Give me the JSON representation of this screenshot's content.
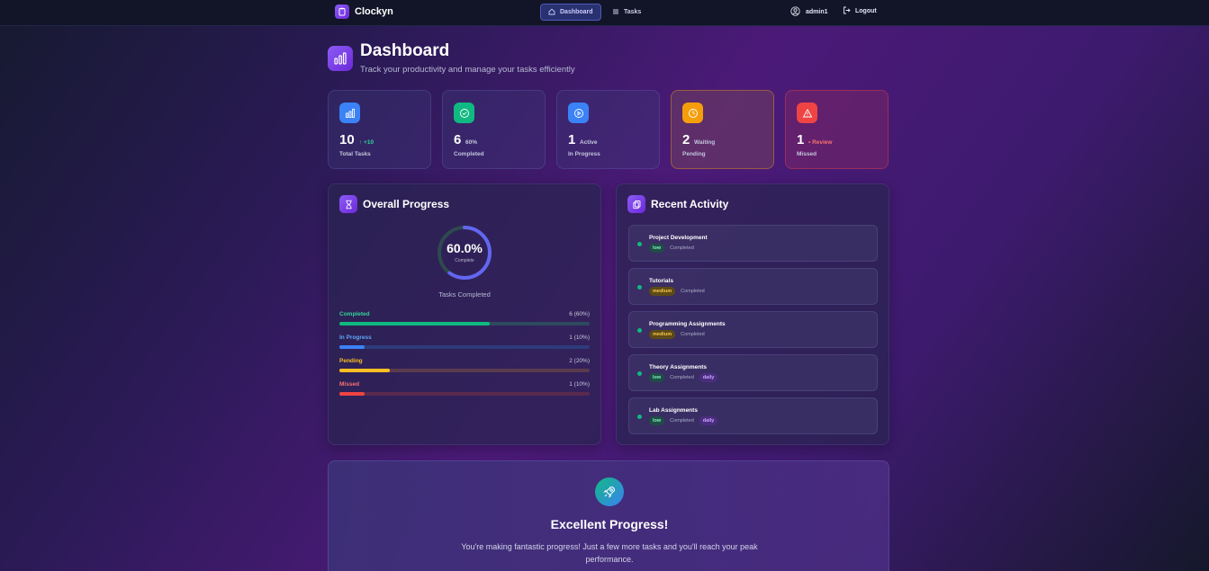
{
  "nav": {
    "brand": "Clockyn",
    "dashboard_label": "Dashboard",
    "tasks_label": "Tasks",
    "user": "admin1",
    "logout_label": "Logout"
  },
  "header": {
    "title": "Dashboard",
    "subtitle": "Track your productivity and manage your tasks efficiently"
  },
  "stats": [
    {
      "value": "10",
      "extra": "↑ +10",
      "label": "Total Tasks",
      "color": "#3b82f6"
    },
    {
      "value": "6",
      "extra": "60%",
      "label": "Completed",
      "color": "#10b981"
    },
    {
      "value": "1",
      "extra": "Active",
      "label": "In Progress",
      "color": "#3b82f6"
    },
    {
      "value": "2",
      "extra": "Waiting",
      "label": "Pending",
      "color": "#f59e0b"
    },
    {
      "value": "1",
      "extra": "• Review",
      "label": "Missed",
      "color": "#ef4444"
    }
  ],
  "overall": {
    "title": "Overall Progress",
    "percent_text": "60.0%",
    "percent": 60,
    "complete_label": "Complete",
    "caption": "Tasks Completed",
    "rows": [
      {
        "label": "Completed",
        "value": "6 (60%)",
        "fraction": 0.6,
        "color": "#10b981",
        "track": "#2e4a5e",
        "label_color": "#34d399"
      },
      {
        "label": "In Progress",
        "value": "1 (10%)",
        "fraction": 0.1,
        "color": "#3b82f6",
        "track": "#2d3b7a",
        "label_color": "#60a5fa"
      },
      {
        "label": "Pending",
        "value": "2 (20%)",
        "fraction": 0.2,
        "color": "#fbbf24",
        "track": "#5a3b4e",
        "label_color": "#fbbf24"
      },
      {
        "label": "Missed",
        "value": "1 (10%)",
        "fraction": 0.1,
        "color": "#ef4444",
        "track": "#5a2a4e",
        "label_color": "#f87171"
      }
    ]
  },
  "activity": {
    "title": "Recent Activity",
    "items": [
      {
        "title": "Project Development",
        "priority": "low",
        "status": "Completed",
        "tag": ""
      },
      {
        "title": "Tutorials",
        "priority": "medium",
        "status": "Completed",
        "tag": ""
      },
      {
        "title": "Programming Assignments",
        "priority": "medium",
        "status": "Completed",
        "tag": ""
      },
      {
        "title": "Theory Assignments",
        "priority": "low",
        "status": "Completed",
        "tag": "daily"
      },
      {
        "title": "Lab Assignments",
        "priority": "low",
        "status": "Completed",
        "tag": "daily"
      }
    ]
  },
  "cta": {
    "title": "Excellent Progress!",
    "text": "You're making fantastic progress! Just a few more tasks and you'll reach your peak performance."
  }
}
